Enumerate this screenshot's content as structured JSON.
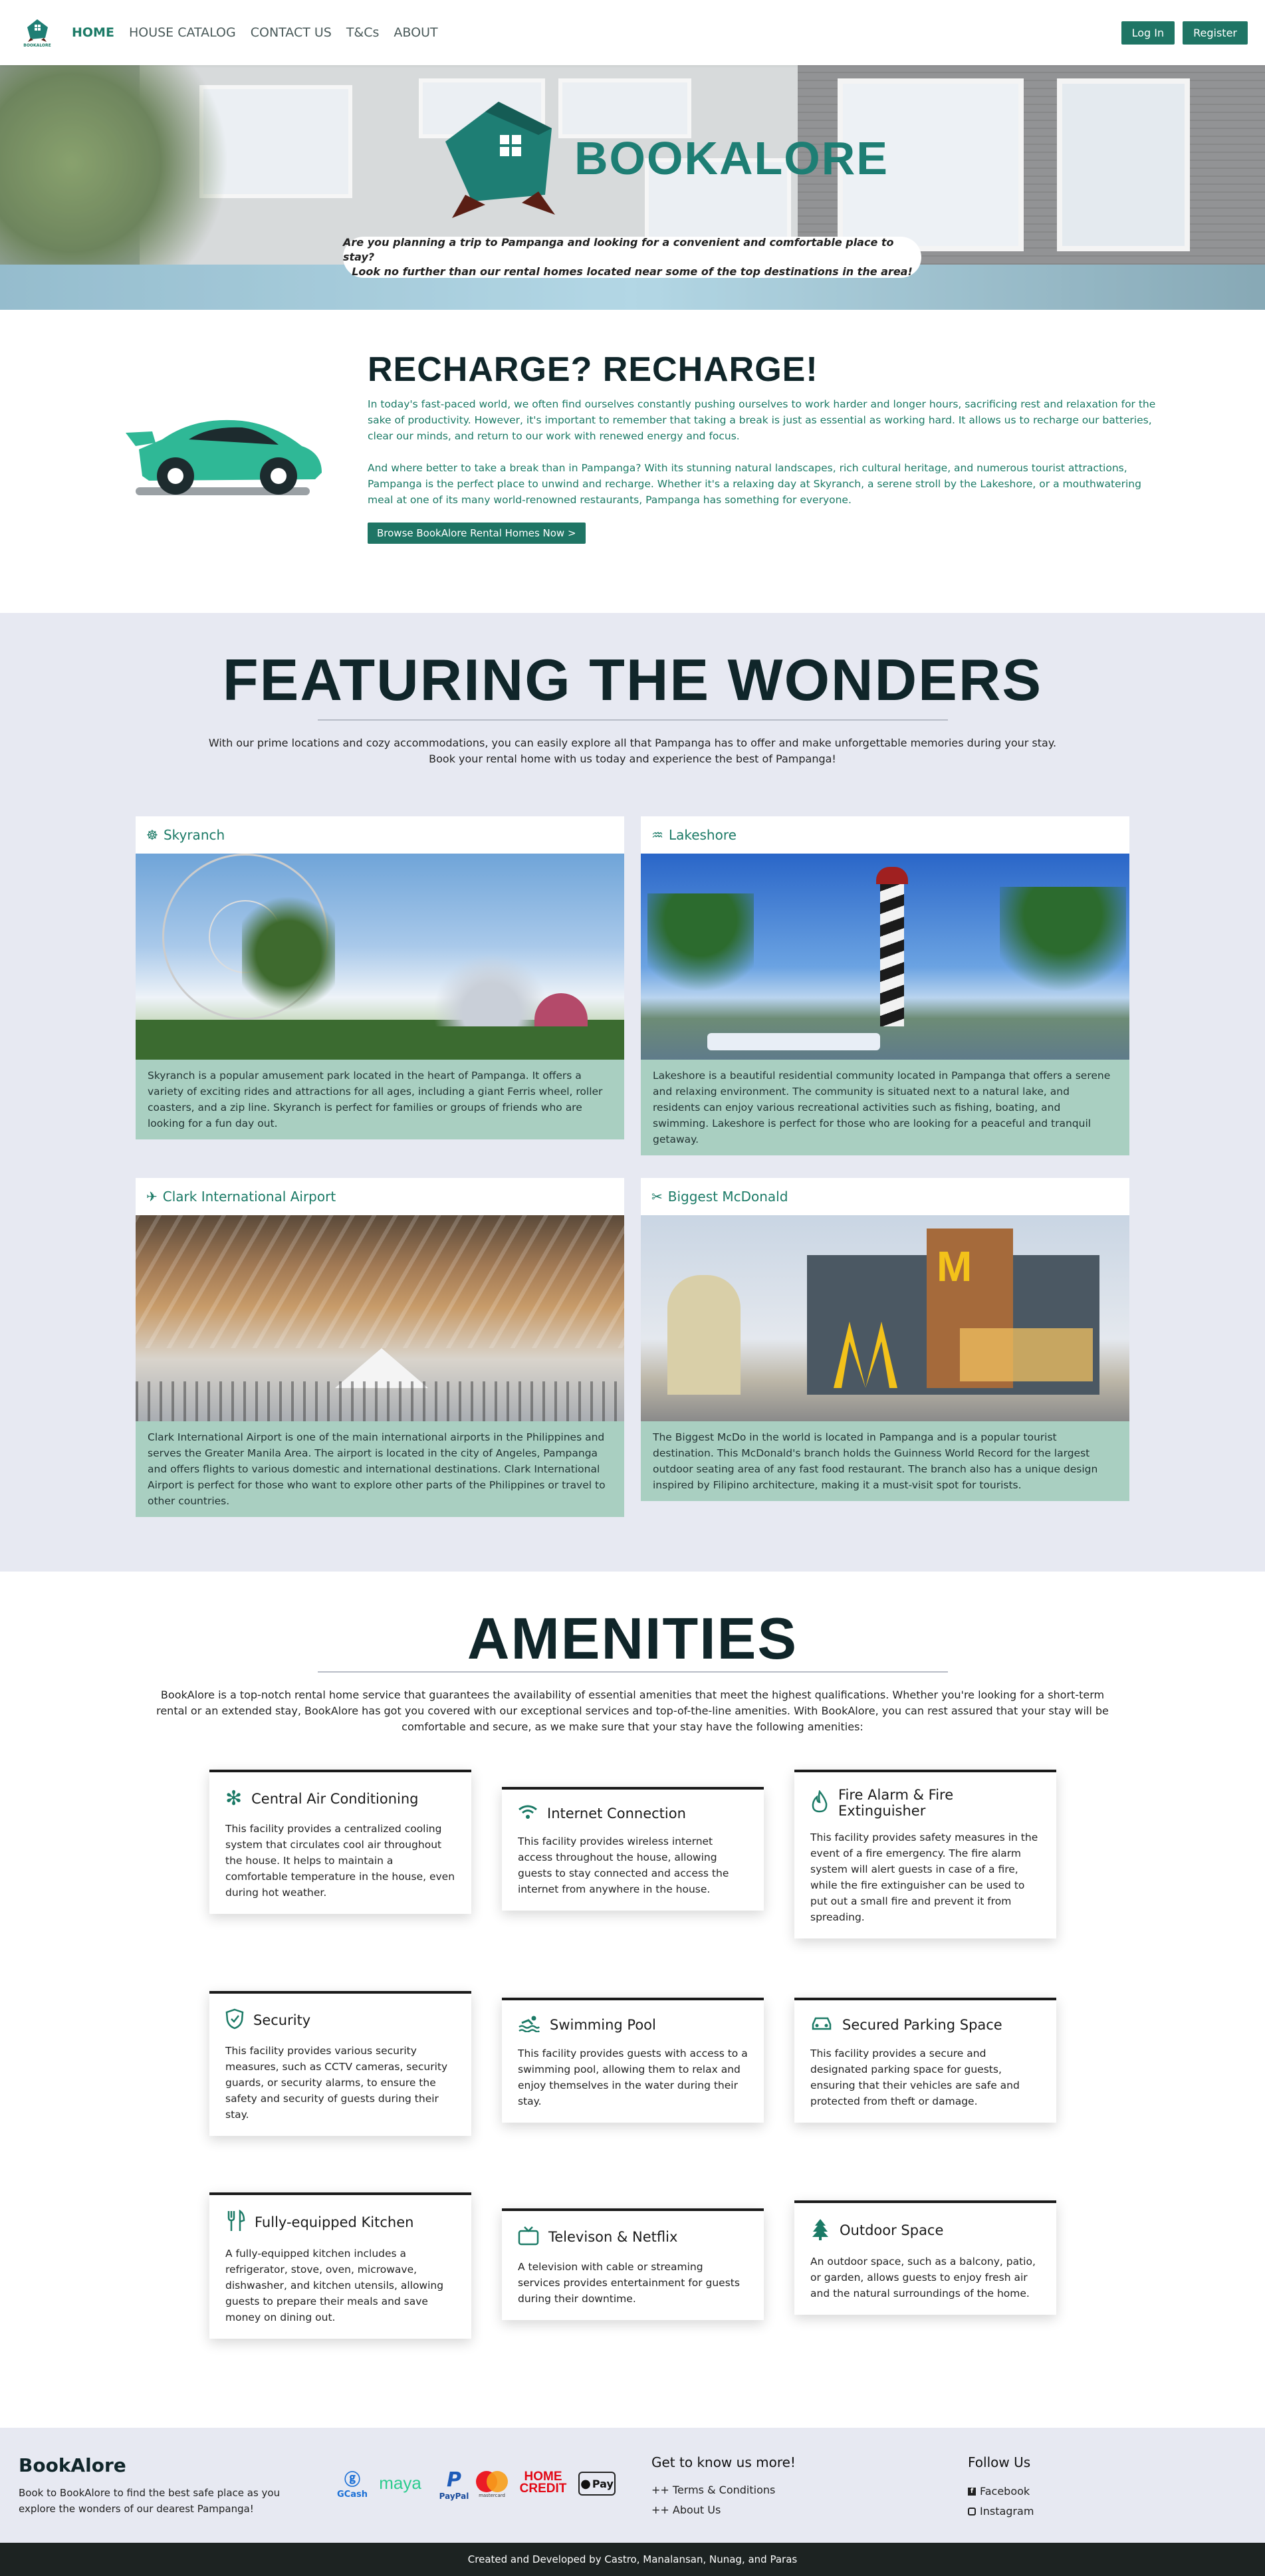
{
  "nav": {
    "logo_text": "BOOKALORE",
    "links": [
      "HOME",
      "HOUSE CATALOG",
      "CONTACT US",
      "T&Cs",
      "ABOUT"
    ],
    "login": "Log In",
    "register": "Register"
  },
  "hero": {
    "title": "BOOKALORE",
    "tagline_1": "Are you planning a trip to Pampanga and looking for a convenient and comfortable place to stay?",
    "tagline_2": "Look no further than our rental homes located near some of the top destinations in the area!"
  },
  "recharge": {
    "title": "RECHARGE? RECHARGE!",
    "p1": "In today's fast-paced world, we often find ourselves constantly pushing ourselves to work harder and longer hours, sacrificing rest and relaxation for the sake of productivity. However, it's important to remember that taking a break is just as essential as working hard. It allows us to recharge our batteries, clear our minds, and return to our work with renewed energy and focus.",
    "p2": "And where better to take a break than in Pampanga? With its stunning natural landscapes, rich cultural heritage, and numerous tourist attractions, Pampanga is the perfect place to unwind and recharge. Whether it's a relaxing day at Skyranch, a serene stroll by the Lakeshore, or a mouthwatering meal at one of its many world-renowned restaurants, Pampanga has something for everyone.",
    "button": "Browse BookAlore Rental Homes Now >"
  },
  "features": {
    "title": "FEATURING THE WONDERS",
    "sub_1": "With our prime locations and cozy accommodations, you can easily explore all that Pampanga has to offer and make unforgettable memories during your stay.",
    "sub_2": "Book your rental home with us today and experience the best of Pampanga!",
    "cards": [
      {
        "title": "Skyranch",
        "icon": "ferris-wheel-icon",
        "desc": "Skyranch is a popular amusement park located in the heart of Pampanga. It offers a variety of exciting rides and attractions for all ages, including a giant Ferris wheel, roller coasters, and a zip line. Skyranch is perfect for families or groups of friends who are looking for a fun day out."
      },
      {
        "title": "Lakeshore",
        "icon": "water-icon",
        "desc": "Lakeshore is a beautiful residential community located in Pampanga that offers a serene and relaxing environment. The community is situated next to a natural lake, and residents can enjoy various recreational activities such as fishing, boating, and swimming. Lakeshore is perfect for those who are looking for a peaceful and tranquil getaway."
      },
      {
        "title": "Clark International Airport",
        "icon": "plane-icon",
        "desc": "Clark International Airport is one of the main international airports in the Philippines and serves the Greater Manila Area. The airport is located in the city of Angeles, Pampanga and offers flights to various domestic and international destinations. Clark International Airport is perfect for those who want to explore other parts of the Philippines or travel to other countries."
      },
      {
        "title": "Biggest McDonald",
        "icon": "utensils-icon",
        "desc": "The Biggest McDo in the world is located in Pampanga and is a popular tourist destination. This McDonald's branch holds the Guinness World Record for the largest outdoor seating area of any fast food restaurant. The branch also has a unique design inspired by Filipino architecture, making it a must-visit spot for tourists."
      }
    ]
  },
  "amenities": {
    "title": "AMENITIES",
    "sub_1": "BookAlore is a top-notch rental home service that guarantees the availability of essential amenities that meet the highest qualifications. Whether you're looking for a short-term",
    "sub_2": "rental or an extended stay, BookAlore has got you covered with our exceptional services and top-of-the-line amenities. With BookAlore, you can rest assured that your stay will be",
    "sub_3": "comfortable and secure, as we make sure that your stay have the following amenities:",
    "items": [
      {
        "title": "Central Air Conditioning",
        "icon": "snowflake-icon",
        "desc": "This facility provides a centralized cooling system that circulates cool air throughout the house. It helps to maintain a comfortable temperature in the house, even during hot weather."
      },
      {
        "title": "Internet Connection",
        "icon": "wifi-icon",
        "desc": "This facility provides wireless internet access throughout the house, allowing guests to stay connected and access the internet from anywhere in the house."
      },
      {
        "title": "Fire Alarm & Fire Extinguisher",
        "icon": "fire-icon",
        "desc": "This facility provides safety measures in the event of a fire emergency. The fire alarm system will alert guests in case of a fire, while the fire extinguisher can be used to put out a small fire and prevent it from spreading."
      },
      {
        "title": "Security",
        "icon": "shield-icon",
        "desc": "This facility provides various security measures, such as CCTV cameras, security guards, or security alarms, to ensure the safety and security of guests during their stay."
      },
      {
        "title": "Swimming Pool",
        "icon": "swimmer-icon",
        "desc": "This facility provides guests with access to a swimming pool, allowing them to relax and enjoy themselves in the water during their stay."
      },
      {
        "title": "Secured Parking Space",
        "icon": "car-icon",
        "desc": "This facility provides a secure and designated parking space for guests, ensuring that their vehicles are safe and protected from theft or damage."
      },
      {
        "title": "Fully-equipped Kitchen",
        "icon": "utensils-icon",
        "desc": "A fully-equipped kitchen includes a refrigerator, stove, oven, microwave, dishwasher, and kitchen utensils, allowing guests to prepare their meals and save money on dining out."
      },
      {
        "title": "Televison & Netflix",
        "icon": "tv-icon",
        "desc": "A television with cable or streaming services provides entertainment for guests during their downtime."
      },
      {
        "title": "Outdoor Space",
        "icon": "tree-icon",
        "desc": "An outdoor space, such as a balcony, patio, or garden, allows guests to enjoy fresh air and the natural surroundings of the home."
      }
    ]
  },
  "footer": {
    "brand": "BookAlore",
    "desc": "Book to BookAlore to find the best safe place as you explore the wonders of our dearest Pampanga!",
    "payments": {
      "gcash": "GCash",
      "maya": "maya",
      "paypal": "PayPal",
      "mastercard": "mastercard",
      "homecredit_1": "HOME",
      "homecredit_2": "CREDIT",
      "applepay": "Pay"
    },
    "know_title": "Get to know us more!",
    "links": [
      "++ Terms & Conditions",
      "++ About Us"
    ],
    "follow_title": "Follow Us",
    "social": [
      "Facebook",
      "Instagram"
    ],
    "copyright": "Created and Developed by Castro, Manalansan, Nunag, and Paras"
  }
}
